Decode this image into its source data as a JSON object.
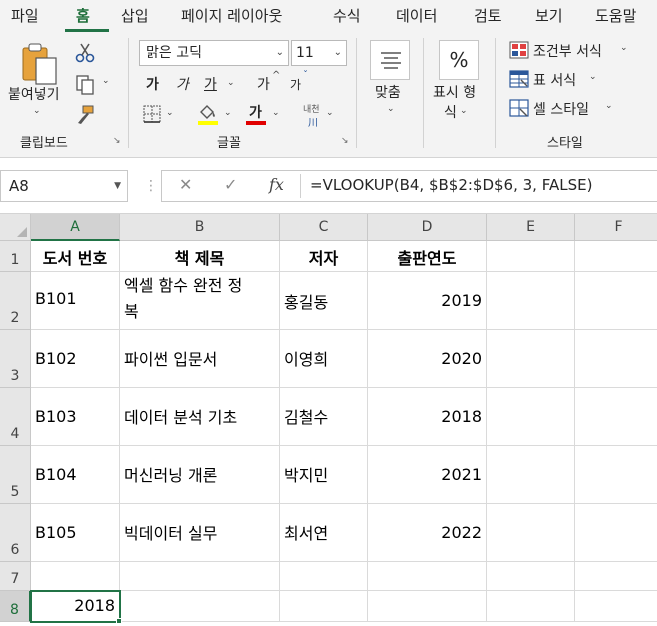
{
  "ribbon_tabs": [
    "파일",
    "홈",
    "삽입",
    "페이지 레이아웃",
    "수식",
    "데이터",
    "검토",
    "보기",
    "도움말"
  ],
  "active_tab": "홈",
  "clipboard": {
    "paste_label": "붙여넣기",
    "group_label": "클립보드"
  },
  "font": {
    "name": "맑은 고딕",
    "size": "11",
    "bold_label": "가",
    "italic_label": "가",
    "underline_label": "가",
    "grow_label": "가",
    "shrink_label": "가",
    "font_color_label": "가",
    "phonetic_label": "내천",
    "group_label": "글꼴"
  },
  "alignment": {
    "label": "맞춤"
  },
  "number": {
    "symbol": "%",
    "label_line1": "표시 형",
    "label_line2": "식"
  },
  "styles": {
    "conditional_label": "조건부 서식",
    "table_label": "표 서식",
    "cell_style_label": "셀 스타일",
    "group_label": "스타일"
  },
  "name_box": "A8",
  "formula_bar": {
    "cancel_symbol": "✕",
    "enter_symbol": "✓",
    "fx_symbol": "fx",
    "formula": "=VLOOKUP(B4, $B$2:$D$6, 3, FALSE)"
  },
  "columns": [
    "A",
    "B",
    "C",
    "D",
    "E",
    "F"
  ],
  "selected_column": "A",
  "rows": [
    "1",
    "2",
    "3",
    "4",
    "5",
    "6",
    "7",
    "8"
  ],
  "selected_row": "8",
  "table": {
    "headers": [
      "도서 번호",
      "책 제목",
      "저자",
      "출판연도"
    ],
    "records": [
      {
        "id": "B101",
        "title_line1": "엑셀 함수 완전 정",
        "title_line2": "복",
        "author": "홍길동",
        "year": "2019"
      },
      {
        "id": "B102",
        "title_line1": "파이썬 입문서",
        "title_line2": "",
        "author": "이영희",
        "year": "2020"
      },
      {
        "id": "B103",
        "title_line1": "데이터 분석 기초",
        "title_line2": "",
        "author": "김철수",
        "year": "2018"
      },
      {
        "id": "B104",
        "title_line1": "머신러닝 개론",
        "title_line2": "",
        "author": "박지민",
        "year": "2021"
      },
      {
        "id": "B105",
        "title_line1": "빅데이터 실무",
        "title_line2": "",
        "author": "최서연",
        "year": "2022"
      }
    ]
  },
  "result_cell": {
    "value": "2018"
  },
  "colors": {
    "accent": "#217346",
    "highlight_yellow": "#ffff00",
    "font_red": "#e00000"
  }
}
